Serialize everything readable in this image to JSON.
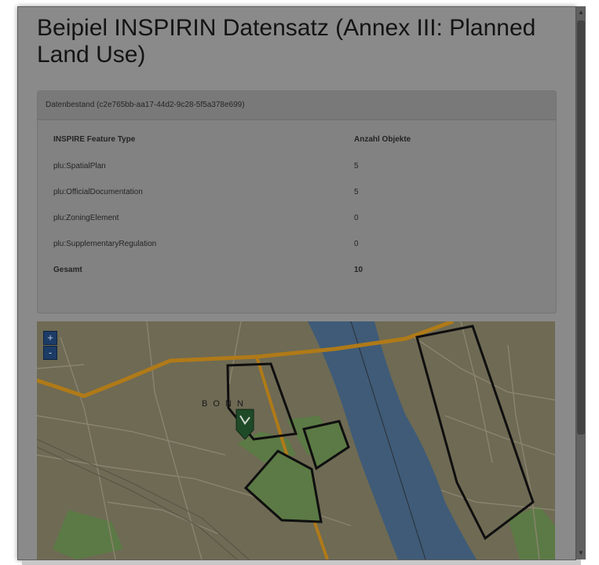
{
  "dialog": {
    "title": "Beipiel INSPIRIN Datensatz (Annex III: Planned Land Use)"
  },
  "dataset_panel": {
    "heading": "Datenbestand (c2e765bb-aa17-44d2-9c28-5f5a378e699)",
    "columns": [
      "INSPIRE Feature Type",
      "Anzahl Objekte"
    ],
    "rows": [
      {
        "type": "plu:SpatialPlan",
        "count": "5"
      },
      {
        "type": "plu:OfficialDocumentation",
        "count": "5"
      },
      {
        "type": "plu:ZoningElement",
        "count": "0"
      },
      {
        "type": "plu:SupplementaryRegulation",
        "count": "0"
      }
    ],
    "total": {
      "label": "Gesamt",
      "count": "10"
    }
  },
  "map": {
    "zoom_in": "+",
    "zoom_out": "-",
    "city_label": "B O N N",
    "marker_icon": "map-marker-icon",
    "colors": {
      "land": "#6e6a54",
      "river": "#3f5b78",
      "park": "#5c7a45",
      "main_road": "#b07a18",
      "plan_outline": "#0f0f0f"
    }
  },
  "scrollbar": {
    "up_icon": "scroll-up-icon",
    "down_icon": "scroll-down-icon"
  }
}
